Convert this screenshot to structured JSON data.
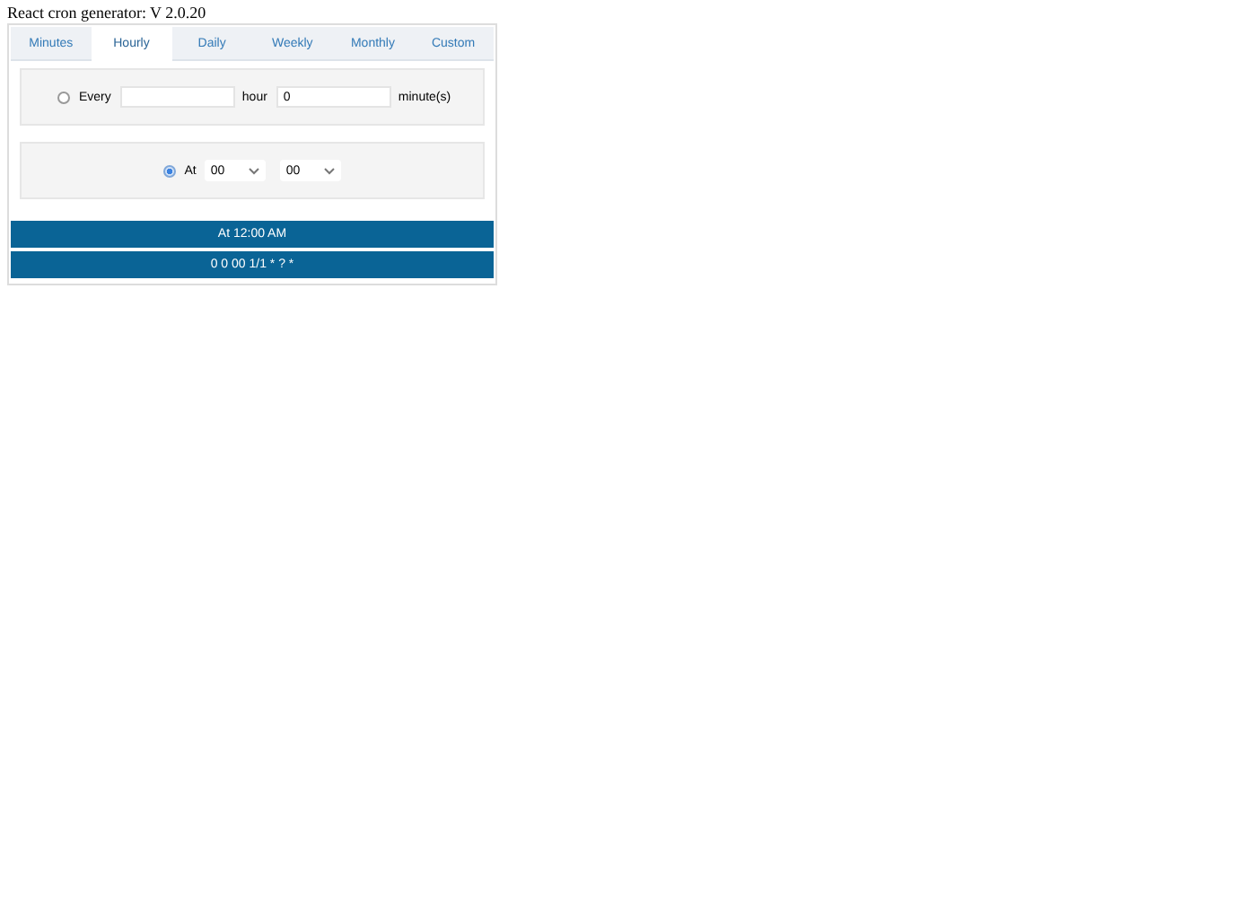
{
  "title": "React cron generator: V 2.0.20",
  "tabs": [
    {
      "label": "Minutes",
      "selected": false
    },
    {
      "label": "Hourly",
      "selected": true
    },
    {
      "label": "Daily",
      "selected": false
    },
    {
      "label": "Weekly",
      "selected": false
    },
    {
      "label": "Monthly",
      "selected": false
    },
    {
      "label": "Custom",
      "selected": false
    }
  ],
  "every_option": {
    "selected": false,
    "label": "Every",
    "hour_label": "hour",
    "minutes_value": "0",
    "minutes_label": "minute(s)"
  },
  "at_option": {
    "selected": true,
    "label": "At",
    "hour_select": "00",
    "minute_select": "00"
  },
  "results": [
    "At 12:00 AM",
    "0 0 00 1/1 * ? *"
  ]
}
